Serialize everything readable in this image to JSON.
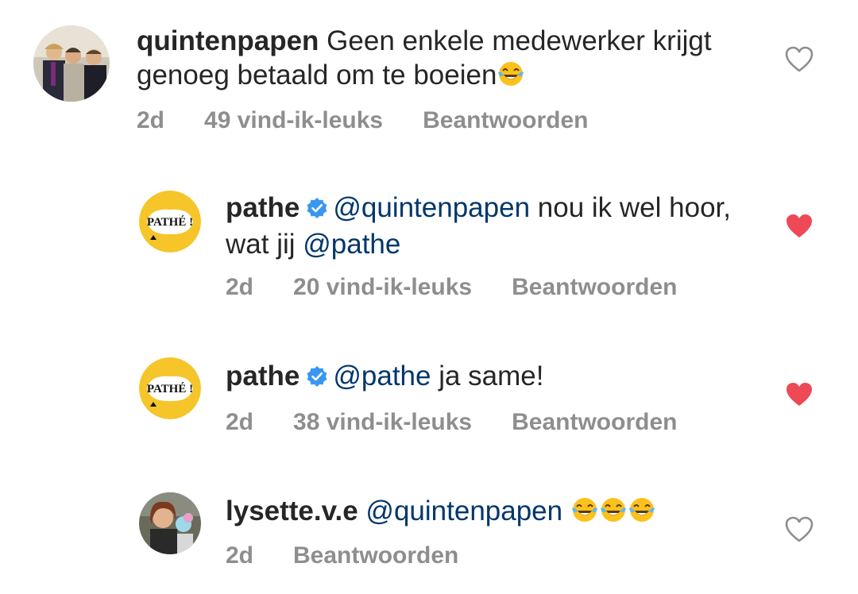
{
  "comments": [
    {
      "username": "quintenpapen",
      "verified": false,
      "text_parts": [
        {
          "type": "text",
          "value": " Geen enkele medewerker krijgt genoeg betaald om te boeien"
        }
      ],
      "emoji_count": 1,
      "emoji_icon": "tears-of-joy-emoji",
      "time": "2d",
      "likes": "49 vind-ik-leuks",
      "reply": "Beantwoorden",
      "liked": false
    },
    {
      "username": "pathe",
      "verified": true,
      "avatar_text": "PATHÉ !",
      "mention": "@quintenpapen",
      "text": " nou ik wel hoor, wat jij ",
      "mention2": "@pathe",
      "time": "2d",
      "likes": "20 vind-ik-leuks",
      "reply": "Beantwoorden",
      "liked": true
    },
    {
      "username": "pathe",
      "verified": true,
      "avatar_text": "PATHÉ !",
      "mention": "@pathe",
      "text": " ja same!",
      "time": "2d",
      "likes": "38 vind-ik-leuks",
      "reply": "Beantwoorden",
      "liked": true
    },
    {
      "username": "lysette.v.e",
      "verified": false,
      "mention": "@quintenpapen",
      "emoji_count": 3,
      "emoji_icon": "tears-of-joy-emoji",
      "time": "2d",
      "reply": "Beantwoorden",
      "liked": false
    }
  ],
  "colors": {
    "text": "#262626",
    "mention": "#00376b",
    "meta": "#8e8e8e",
    "heart_liked": "#ed4956",
    "heart_outline": "#8e8e8e",
    "verified": "#3897f0",
    "pathe_yellow": "#f5c52a"
  }
}
